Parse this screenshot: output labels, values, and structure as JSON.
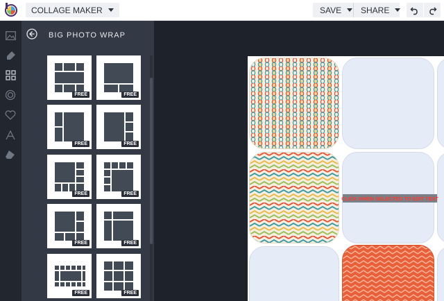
{
  "header": {
    "app_menu_label": "COLLAGE MAKER",
    "save_label": "SAVE",
    "share_label": "SHARE",
    "undo_icon": "undo-icon",
    "redo_icon": "redo-icon"
  },
  "rail": {
    "items": [
      {
        "name": "image-icon"
      },
      {
        "name": "brush-icon"
      },
      {
        "name": "layout-grid-icon"
      },
      {
        "name": "circle-icon"
      },
      {
        "name": "heart-icon"
      },
      {
        "name": "text-icon"
      },
      {
        "name": "eraser-icon"
      }
    ]
  },
  "panel": {
    "title": "BIG PHOTO WRAP",
    "back_icon": "arrow-left-circle-icon",
    "templates": [
      {
        "badge": "FREE"
      },
      {
        "badge": "FREE"
      },
      {
        "badge": "FREE"
      },
      {
        "badge": "FREE"
      },
      {
        "badge": "FREE"
      },
      {
        "badge": "FREE"
      },
      {
        "badge": "FREE"
      },
      {
        "badge": "FREE"
      },
      {
        "badge": "FREE"
      },
      {
        "badge": "FREE"
      }
    ]
  },
  "canvas": {
    "edit_text": "CLICK WHEN SELECTED TO EDIT TEXT"
  },
  "colors": {
    "header_bg": "#ffffff",
    "rail_bg": "#22272f",
    "panel_bg": "#343a45",
    "workspace_bg": "#1e232b",
    "cell_bg": "#e6ebf8",
    "pattern_orange": "#e8603a"
  }
}
